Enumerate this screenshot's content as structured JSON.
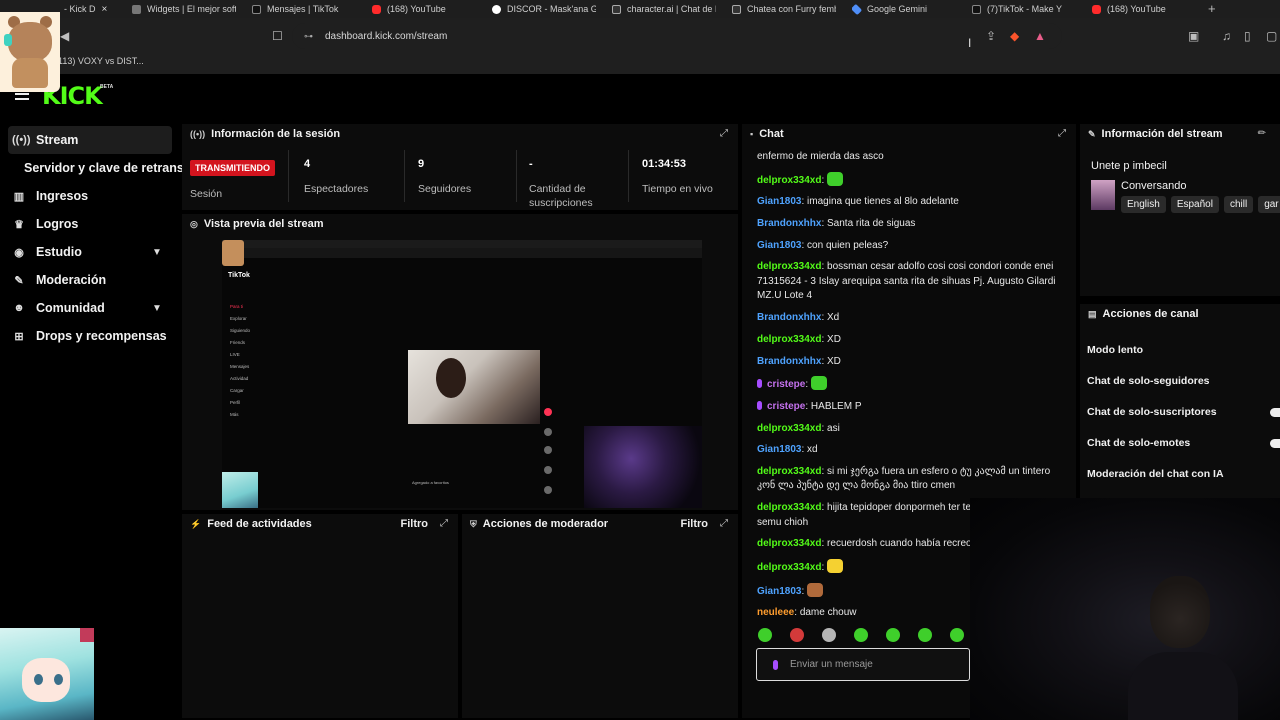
{
  "browser": {
    "tabs": [
      {
        "label": "- Kick D",
        "icon": "kick-icon",
        "active": true
      },
      {
        "label": "Widgets | El mejor soft",
        "icon": "widget-icon"
      },
      {
        "label": "Mensajes | TikTok",
        "icon": "tiktok-icon"
      },
      {
        "label": "(168) YouTube",
        "icon": "youtube-icon"
      },
      {
        "label": "DISCOR - Mask'ana Go",
        "icon": "google-icon"
      },
      {
        "label": "character.ai | Chat de I",
        "icon": "characterai-icon"
      },
      {
        "label": "Chatea con Furry femb",
        "icon": "characterai-icon"
      },
      {
        "label": "Google Gemini",
        "icon": "gemini-icon"
      },
      {
        "label": "(7)TikTok - Make Y",
        "icon": "tiktok-icon"
      },
      {
        "label": "(168) YouTube",
        "icon": "youtube-icon"
      }
    ],
    "new_tab": "+",
    "url": "dashboard.kick.com/stream",
    "bookmark": "113) VOXY vs DIST..."
  },
  "kick": {
    "logo": "KICK",
    "beta": "BETA"
  },
  "sidebar": {
    "items": [
      {
        "label": "Stream",
        "icon": "stream-icon",
        "active": true
      },
      {
        "label": "Servidor y clave de retransmisión",
        "sub": true
      },
      {
        "label": "Ingresos",
        "icon": "chart-icon"
      },
      {
        "label": "Logros",
        "icon": "trophy-icon"
      },
      {
        "label": "Estudio",
        "icon": "studio-icon",
        "chevron": true
      },
      {
        "label": "Moderación",
        "icon": "wrench-icon"
      },
      {
        "label": "Comunidad",
        "icon": "people-icon",
        "chevron": true
      },
      {
        "label": "Drops y recompensas",
        "icon": "drops-icon"
      }
    ]
  },
  "session": {
    "title": "Información de la sesión",
    "live_badge": "TRANSMITIENDO",
    "session_label": "Sesión",
    "stats": [
      {
        "value": "4",
        "label": "Espectadores"
      },
      {
        "value": "9",
        "label": "Seguidores"
      },
      {
        "value": "-",
        "label": "Cantidad de suscripciones"
      },
      {
        "value": "01:34:53",
        "label": "Tiempo en vivo"
      }
    ]
  },
  "preview": {
    "title": "Vista previa del stream",
    "tiktok_label": "TikTok",
    "menu": [
      "Para ti",
      "Explorar",
      "Siguiendo",
      "Friends",
      "LIVE",
      "Mensajes",
      "Actividad",
      "Cargar",
      "Perfil",
      "Más"
    ],
    "caption": "Agregado a favoritos"
  },
  "feed": {
    "title": "Feed de actividades",
    "filter": "Filtro"
  },
  "mod": {
    "title": "Acciones de moderador",
    "filter": "Filtro"
  },
  "chat": {
    "title": "Chat",
    "messages": [
      {
        "user": "",
        "text": "enfermo de mierda das asco",
        "color": "#e9e9e9"
      },
      {
        "user": "delprox334xd",
        "text": "",
        "color": "#53fc18",
        "emote": "green"
      },
      {
        "user": "Gian1803",
        "text": "imagina que tienes al 8lo adelante",
        "color": "#4fa3ff"
      },
      {
        "user": "Brandonxhhx",
        "text": "Santa rita de siguas",
        "color": "#4fa3ff"
      },
      {
        "user": "Gian1803",
        "text": "con quien peleas?",
        "color": "#4fa3ff"
      },
      {
        "user": "delprox334xd",
        "text": "bossman cesar adolfo cosi cosi condori conde enei 71315624 - 3 Islay arequipa santa rita de sihuas Pj. Augusto Gilardi MZ.U Lote 4",
        "color": "#53fc18"
      },
      {
        "user": "Brandonxhhx",
        "text": "Xd",
        "color": "#4fa3ff"
      },
      {
        "user": "delprox334xd",
        "text": "XD",
        "color": "#53fc18"
      },
      {
        "user": "Brandonxhhx",
        "text": "XD",
        "color": "#4fa3ff"
      },
      {
        "user": "cristepe",
        "text": "",
        "color": "#c471ed",
        "badge": true,
        "emote": "green"
      },
      {
        "user": "cristepe",
        "text": "HABLEM P",
        "color": "#c471ed",
        "badge": true
      },
      {
        "user": "delprox334xd",
        "text": "asi",
        "color": "#53fc18"
      },
      {
        "user": "Gian1803",
        "text": "xd",
        "color": "#4fa3ff"
      },
      {
        "user": "delprox334xd",
        "text": "si mi ჯერგა fuera un esfero o ტუ კალამ un tintero კონ ლა პუნტა დე ლა მონგა მია ttiro cmen",
        "color": "#53fc18"
      },
      {
        "user": "delprox334xd",
        "text": "hijita tepidoper donpormeh ter tel no fulanal perogoh semu chioh",
        "color": "#53fc18"
      },
      {
        "user": "delprox334xd",
        "text": "recuerdosh cuando había recreo",
        "color": "#53fc18"
      },
      {
        "user": "delprox334xd",
        "text": "",
        "color": "#53fc18",
        "emote": "yellow"
      },
      {
        "user": "Gian1803",
        "text": "",
        "color": "#4fa3ff",
        "emote": "brown"
      },
      {
        "user": "neuleee",
        "text": "dame chouw",
        "color": "#ff9d2e"
      }
    ],
    "emote_bar": [
      "#3fcf2b",
      "#d33a3a",
      "#b5b5b5",
      "#3fcf2b",
      "#3fcf2b",
      "#3fcf2b",
      "#3fcf2b"
    ],
    "input_placeholder": "Enviar un mensaje"
  },
  "stream_info": {
    "title": "Información del stream",
    "stream_title": "Unete p imbecil",
    "category": "Conversando",
    "tags": [
      "English",
      "Español",
      "chill",
      "gar"
    ]
  },
  "channel_actions": {
    "title": "Acciones de canal",
    "items": [
      {
        "label": "Modo lento",
        "toggle": false
      },
      {
        "label": "Chat de solo-seguidores",
        "toggle": false
      },
      {
        "label": "Chat de solo-suscriptores",
        "toggle": true
      },
      {
        "label": "Chat de solo-emotes",
        "toggle": true
      },
      {
        "label": "Moderación del chat con IA",
        "toggle": false
      }
    ]
  }
}
